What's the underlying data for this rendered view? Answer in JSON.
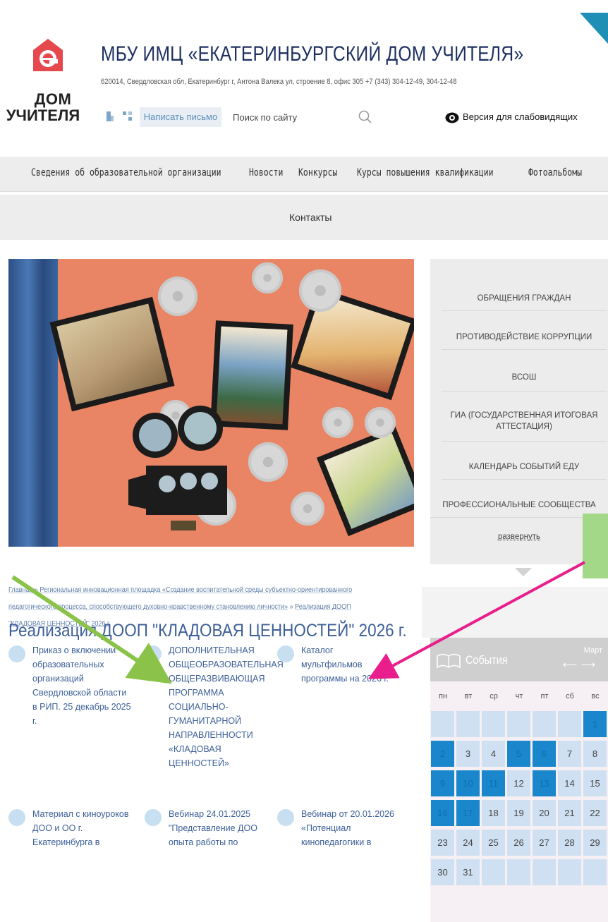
{
  "header": {
    "logo_line1": "ДОМ",
    "logo_line2": "УЧИТЕЛЯ",
    "title": "МБУ ИМЦ «ЕКАТЕРИНБУРГСКИЙ ДОМ УЧИТЕЛЯ»",
    "address": "620014, Свердловская обл, Екатеринбург г, Антона Валека ул, строение 8, офис 305     +7 (343) 304-12-49, 304-12-48",
    "write_label": "Написать письмо",
    "search_placeholder": "Поиск по сайту",
    "vision_label": "Версия для слабовидящих"
  },
  "nav": {
    "items": [
      "Сведения об образовательной организации",
      "Новости",
      "Конкурсы",
      "Курсы повышения квалификации",
      "Фотоальбомы"
    ],
    "contacts": "Контакты"
  },
  "breadcrumb": {
    "home": "Главная",
    "sep": " » ",
    "level1": "Региональная инновационная площадка «Создание воспитательной среды субъектно-ориентированного педагогического процесса, способствующего духовно-нравственному становлению личности»",
    "current": "Реализация ДООП \"КЛАДОВАЯ ЦЕННОСТЕЙ\" 2026 г."
  },
  "page_title": "Реализация ДООП \"КЛАДОВАЯ ЦЕННОСТЕЙ\" 2026 г.",
  "documents": [
    {
      "text": "Приказ о включении образовательных организаций Свердловской области в РИП. 25 декабрь 2025 г."
    },
    {
      "text": "ДОПОЛНИТЕЛЬНАЯ ОБЩЕОБРАЗОВАТЕЛЬНАЯ ОБЩЕРАЗВИВАЮЩАЯ ПРОГРАММА СОЦИАЛЬНО-ГУМАНИТАРНОЙ НАПРАВЛЕННОСТИ «КЛАДОВАЯ ЦЕННОСТЕЙ»"
    },
    {
      "text": "Каталог мультфильмов программы на 2026 г."
    },
    {
      "text": "Материал с киноуроков ДОО и ОО г. Екатеринбурга в"
    },
    {
      "text": "Вебинар 24.01.2025 \"Представление ДОО опыта работы по"
    },
    {
      "text": "Вебинар от 20.01.2026 «Потенциал кинопедагогики в"
    }
  ],
  "side_menu": {
    "items": [
      "ОБРАЩЕНИЯ ГРАЖДАН",
      "ПРОТИВОДЕЙСТВИЕ КОРРУПЦИИ",
      "ВСОШ",
      "ГИА (ГОСУДАРСТВЕННАЯ ИТОГОВАЯ АТТЕСТАЦИЯ)",
      "КАЛЕНДАРЬ СОБЫТИЙ ЕДУ",
      "ПРОФЕССИОНАЛЬНЫЕ СООБЩЕСТВА"
    ],
    "expand": "развернуть"
  },
  "events": {
    "label": "События",
    "month": "Март",
    "weekdays": [
      "пн",
      "вт",
      "ср",
      "чт",
      "пт",
      "сб",
      "вс"
    ],
    "weeks": [
      [
        "",
        "",
        "",
        "",
        "",
        "",
        "1"
      ],
      [
        "2",
        "3",
        "4",
        "5",
        "6",
        "7",
        "8"
      ],
      [
        "9",
        "10",
        "11",
        "12",
        "13",
        "14",
        "15"
      ],
      [
        "16",
        "17",
        "18",
        "19",
        "20",
        "21",
        "22"
      ],
      [
        "23",
        "24",
        "25",
        "26",
        "27",
        "28",
        "29"
      ],
      [
        "30",
        "31",
        "",
        "",
        "",
        "",
        ""
      ]
    ],
    "event_days": [
      "1",
      "2",
      "5",
      "6",
      "9",
      "10",
      "11",
      "13",
      "16",
      "17"
    ]
  },
  "colors": {
    "title_blue": "#1d3060",
    "link_blue": "#3c5f98",
    "logo_red": "#e5484d",
    "calendar_event": "#1a86cc",
    "arrow_green": "#8bc34a",
    "arrow_pink": "#e91e8c"
  }
}
